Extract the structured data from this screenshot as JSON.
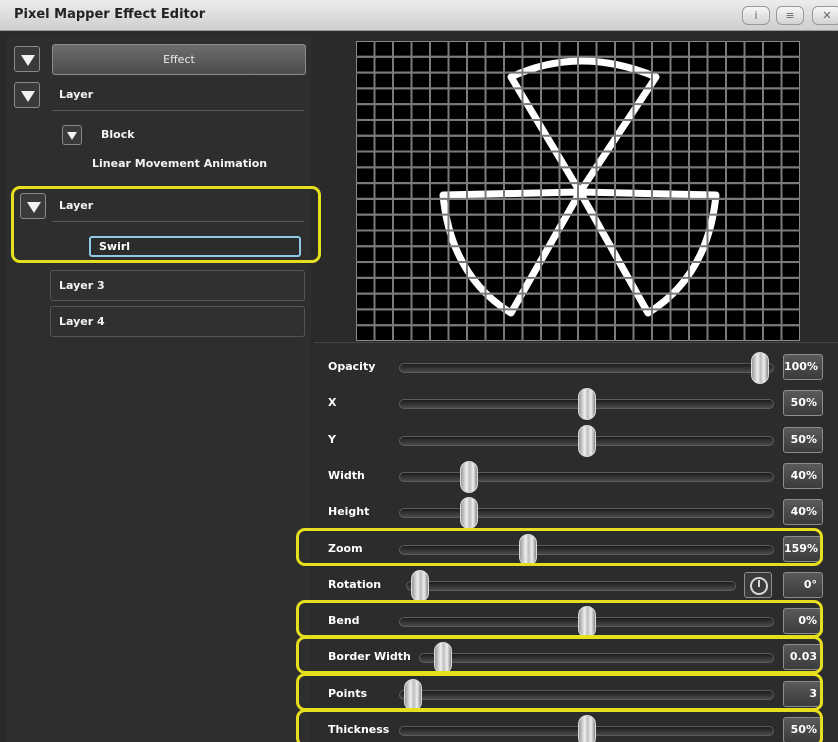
{
  "window": {
    "title": "Pixel Mapper Effect Editor",
    "buttons": [
      {
        "name": "info-button",
        "icon": "info-icon",
        "glyph": "i"
      },
      {
        "name": "menu-button",
        "icon": "menu-icon",
        "glyph": "≡"
      },
      {
        "name": "close-button",
        "icon": "close-icon",
        "glyph": "✕"
      }
    ]
  },
  "tree": {
    "effect_label": "Effect",
    "layer1": {
      "label": "Layer",
      "block_label": "Block",
      "animation_label": "Linear Movement Animation"
    },
    "layer2": {
      "label": "Layer",
      "name_value": "Swirl"
    },
    "layer3": {
      "label": "Layer 3"
    },
    "layer4": {
      "label": "Layer 4"
    }
  },
  "preview": {
    "grid_cols": 24,
    "grid_rows": 19,
    "shape": "triangle-pattern-3-points",
    "line_color": "#ffffff",
    "cell_color": "#000000"
  },
  "sliders": [
    {
      "name": "opacity",
      "label": "Opacity",
      "value": "100%",
      "level": 1.0,
      "highlighted": false
    },
    {
      "name": "x",
      "label": "X",
      "value": "50%",
      "level": 0.5,
      "highlighted": false
    },
    {
      "name": "y",
      "label": "Y",
      "value": "50%",
      "level": 0.5,
      "highlighted": false
    },
    {
      "name": "width",
      "label": "Width",
      "value": "40%",
      "level": 0.16,
      "highlighted": false
    },
    {
      "name": "height",
      "label": "Height",
      "value": "40%",
      "level": 0.16,
      "highlighted": false
    },
    {
      "name": "zoom",
      "label": "Zoom",
      "value": "159%",
      "level": 0.33,
      "highlighted": true
    },
    {
      "name": "rotation",
      "label": "Rotation",
      "value": "0°",
      "level": 0.0,
      "highlighted": false
    },
    {
      "name": "bend",
      "label": "Bend",
      "value": "0%",
      "level": 0.5,
      "highlighted": true
    },
    {
      "name": "border-width",
      "label": "Border Width",
      "value": "0.03",
      "level": 0.03,
      "highlighted": true
    },
    {
      "name": "points",
      "label": "Points",
      "value": "3",
      "level": 0.0,
      "highlighted": true
    },
    {
      "name": "thickness",
      "label": "Thickness",
      "value": "50%",
      "level": 0.5,
      "highlighted": true
    }
  ],
  "colors": {
    "highlight": "#e6df1d",
    "active_field": "#8fc9e6"
  }
}
